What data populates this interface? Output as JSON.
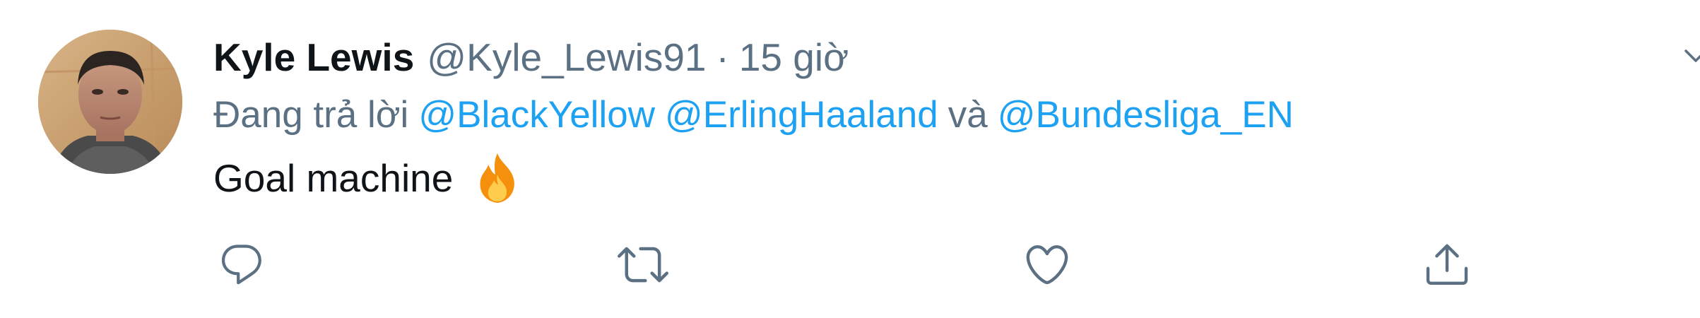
{
  "tweet": {
    "author_name": "Kyle Lewis",
    "author_handle": "@Kyle_Lewis91",
    "separator": "·",
    "timestamp": "15 giờ",
    "reply_prefix": "Đang trả lời",
    "reply_mentions": [
      "@BlackYellow",
      "@ErlingHaaland",
      "@Bundesliga_EN"
    ],
    "reply_conjunction": "và",
    "text": "Goal machine",
    "emoji": "fire"
  },
  "actions": [
    {
      "name": "reply",
      "icon": "reply-icon"
    },
    {
      "name": "retweet",
      "icon": "retweet-icon"
    },
    {
      "name": "like",
      "icon": "heart-icon"
    },
    {
      "name": "share",
      "icon": "share-icon"
    }
  ],
  "colors": {
    "text_primary": "#0f1419",
    "text_secondary": "#5b7083",
    "link": "#1da1f2",
    "icon": "#5b7083"
  }
}
